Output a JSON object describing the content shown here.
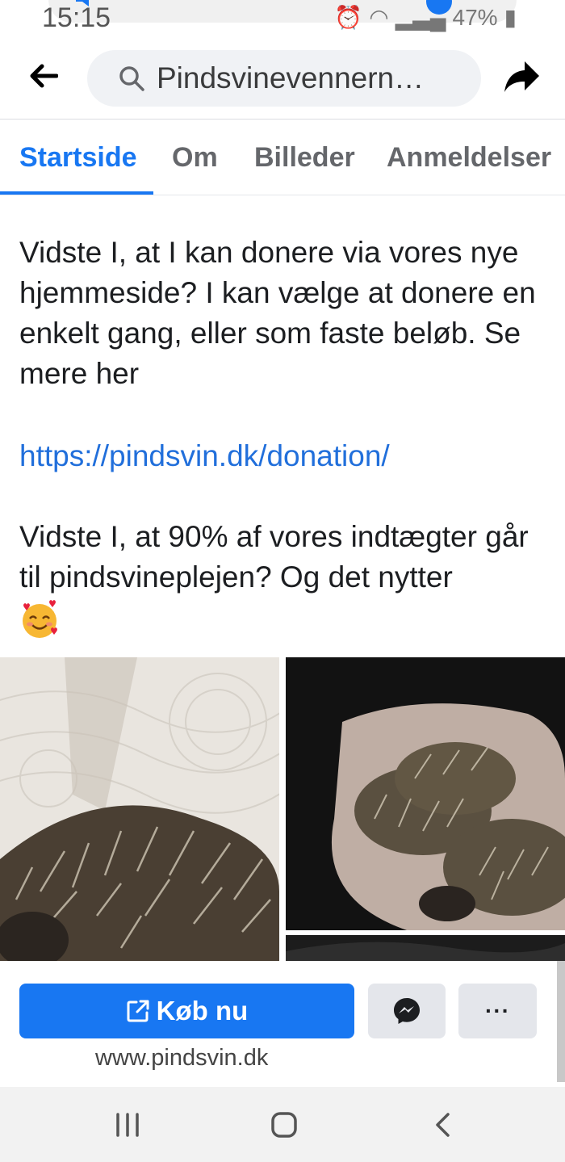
{
  "status_bar": {
    "time": "15:15",
    "battery": "47%"
  },
  "header": {
    "search_text": "Pindsvinevennern…",
    "back_icon": "arrow-left-icon",
    "share_icon": "share-arrow-icon",
    "search_icon": "search-icon"
  },
  "tabs": [
    {
      "label": "Startside",
      "active": true
    },
    {
      "label": "Om",
      "active": false
    },
    {
      "label": "Billeder",
      "active": false
    },
    {
      "label": "Anmeldelser",
      "active": false
    }
  ],
  "post": {
    "paragraph1": "Vidste I, at I kan donere via vores nye hjemmeside? I kan vælge at donere en enkelt gang, eller som faste beløb. Se mere her",
    "link": "https://pindsvin.dk/donation/",
    "paragraph3": "Vidste I, at 90% af vores indtægter går til pindsvineplejen? Og det nytter",
    "emoji": "smiling-face-with-hearts"
  },
  "photos": [
    {
      "subject": "hedgehog-on-paper-towel"
    },
    {
      "subject": "two-hedgehogs-on-blanket"
    }
  ],
  "actions": {
    "buy_label": "Køb nu",
    "website": "www.pindsvin.dk",
    "more_label": "···"
  },
  "colors": {
    "accent": "#1877f2",
    "link": "#216fdb",
    "secondary_button": "#e4e6eb"
  }
}
